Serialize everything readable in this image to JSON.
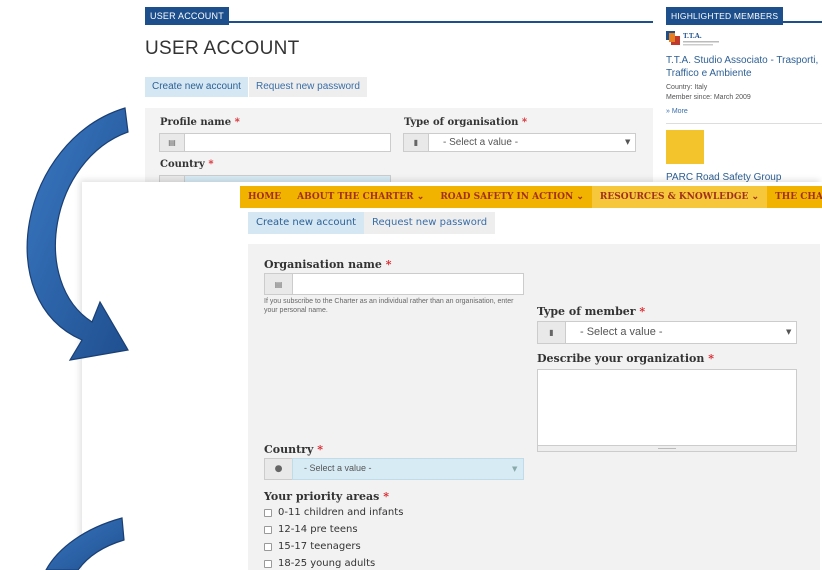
{
  "back": {
    "section_tab": "USER ACCOUNT",
    "page_title": "USER ACCOUNT",
    "tabs": [
      "Create new account",
      "Request new password"
    ],
    "profile_name_label": "Profile name",
    "required_mark": "*",
    "type_org_label": "Type of organisation",
    "type_org_value": "- Select a value -",
    "country_label": "Country",
    "sidebar": {
      "title": "HIGHLIGHTED MEMBERS",
      "logo_text": "T.T.A.",
      "member_name": "T.T.A. Studio Associato - Trasporti, Traffico e Ambiente",
      "country": "Country: Italy",
      "member_since": "Member since: March 2009",
      "more": "» More",
      "next_member": "PARC Road Safety Group"
    }
  },
  "front": {
    "nav": [
      "HOME",
      "ABOUT THE CHARTER ⌄",
      "ROAD SAFETY IN ACTION ⌄",
      "RESOURCES & KNOWLEDGE ⌄",
      "THE CHARTE"
    ],
    "tabs": [
      "Create new account",
      "Request new password"
    ],
    "required_mark": "*",
    "org_name_label": "Organisation name",
    "org_name_help": "If you subscribe to the Charter as an individual rather than an organisation, enter your personal name.",
    "type_member_label": "Type of member",
    "type_member_value": "- Select a value -",
    "describe_label": "Describe your organization",
    "country_label": "Country",
    "country_value": "- Select a value -",
    "priority_label": "Your priority areas",
    "priority_items": [
      "0-11 children and infants",
      "12-14 pre teens",
      "15-17 teenagers",
      "18-25 young adults"
    ]
  },
  "colors": {
    "brand_blue": "#1d4f8c",
    "nav_yellow": "#f2b300",
    "nav_text": "#a0301a",
    "required": "#d9272e",
    "arrow_blue": "#2f67b1"
  }
}
